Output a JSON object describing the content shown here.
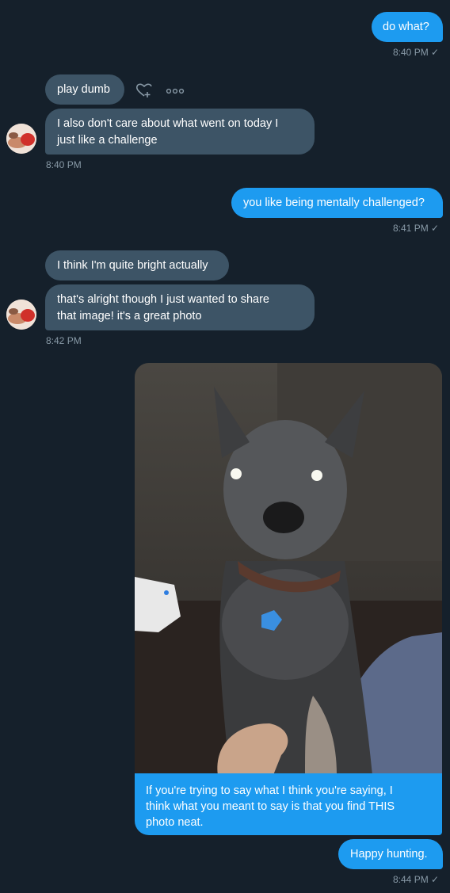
{
  "conversation": {
    "messages": [
      {
        "text": "do what?",
        "time": "8:40 PM ✓"
      },
      {
        "text": "play dumb"
      },
      {
        "text_lines": [
          "I also don't care about what went on today I",
          "just like a challenge"
        ],
        "time": "8:40 PM"
      },
      {
        "text": "you like being mentally challenged?",
        "time": "8:41 PM ✓"
      },
      {
        "text": "I think I'm quite bright actually"
      },
      {
        "text_lines": [
          "that's alright though I just wanted to share",
          "that image! it's a great photo"
        ],
        "time": "8:42 PM"
      },
      {
        "caption_lines": [
          "If you're trying to say what I think you're saying, I",
          "think what you meant to say is that you find THIS",
          "photo neat."
        ]
      },
      {
        "text": "Happy hunting.",
        "time": "8:44 PM ✓"
      }
    ]
  },
  "icons": {
    "like": "heart-plus-icon",
    "more": "more-options-icon"
  },
  "colors": {
    "background": "#15202b",
    "sent_bubble": "#1d9bf0",
    "received_bubble": "#3d5466",
    "timestamp": "#8899a6"
  }
}
